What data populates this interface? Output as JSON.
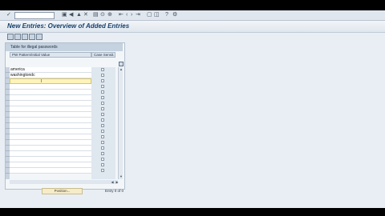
{
  "window": {
    "title": "New Entries: Overview of Added Entries"
  },
  "toolbar": {
    "icons": [
      "enter-icon",
      "save-icon",
      "back-icon",
      "exit-icon",
      "cancel-icon",
      "print-icon",
      "find-icon",
      "find-next-icon",
      "first-page-icon",
      "prev-page-icon",
      "next-page-icon",
      "last-page-icon",
      "new-session-icon",
      "shortcut-icon",
      "help-icon",
      "customize-icon"
    ]
  },
  "app_toolbar": {
    "icons": [
      "change-display-icon",
      "new-entries-icon",
      "copy-as-icon",
      "delete-icon",
      "select-all-icon"
    ]
  },
  "table": {
    "title": "Table for illegal passwords",
    "columns": [
      "PW Pattern/Initial Value",
      "Case Sensit."
    ],
    "rows": [
      {
        "pattern": "america"
      },
      {
        "pattern": "washingtondc"
      },
      {
        "pattern": ""
      }
    ],
    "empty_rows": 16,
    "position_button": "Position...",
    "entry_label": "Entry 0 of 0"
  }
}
